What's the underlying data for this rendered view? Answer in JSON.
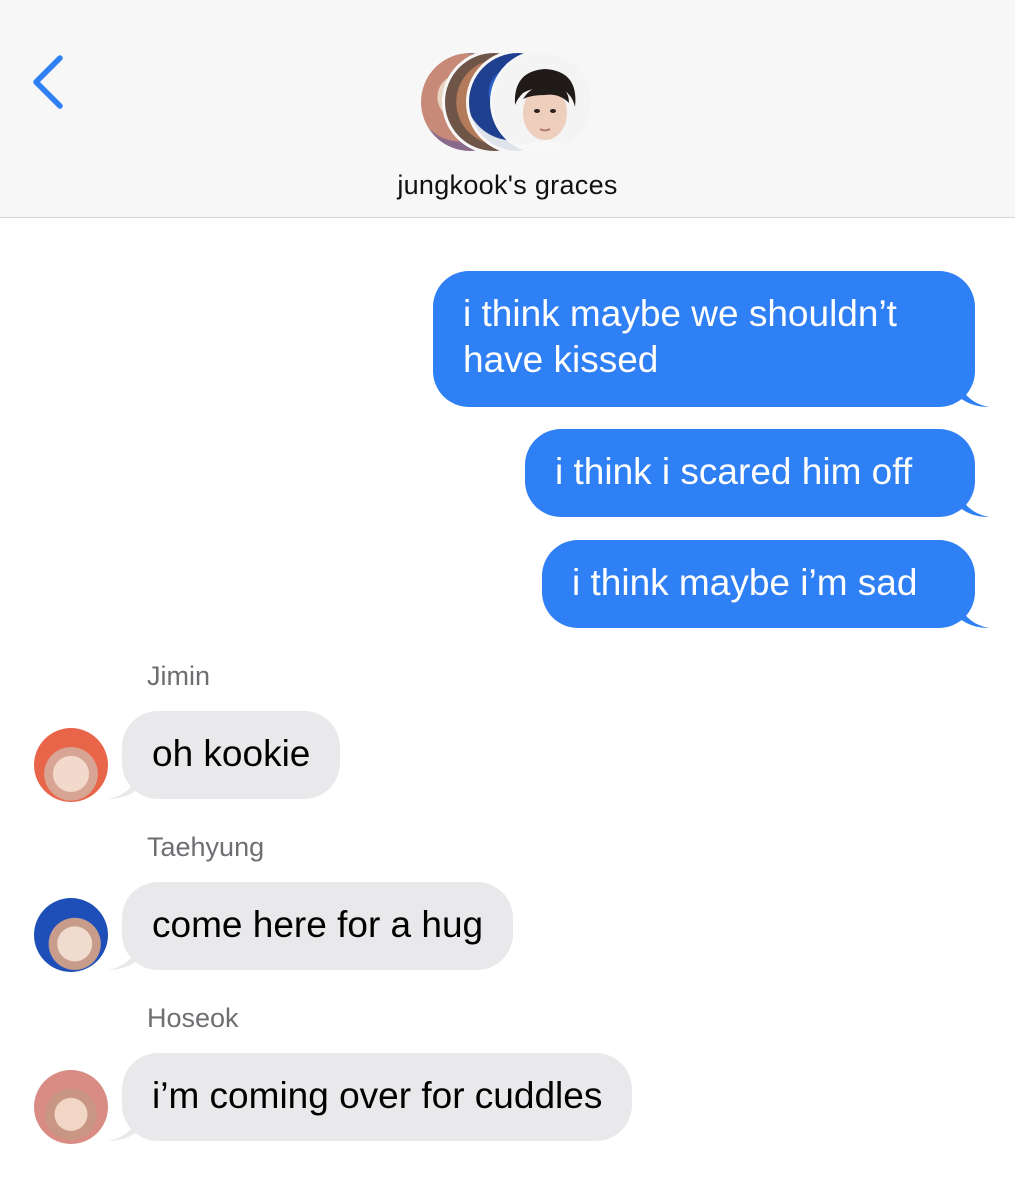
{
  "header": {
    "group_name": "jungkook's graces",
    "avatar_count": 4
  },
  "messages_out": [
    {
      "text": "i think maybe we shouldn’t have kissed"
    },
    {
      "text": "i think i scared him off"
    },
    {
      "text": "i think maybe i’m sad"
    }
  ],
  "messages_in": [
    {
      "sender": "Jimin",
      "text": "oh kookie"
    },
    {
      "sender": "Taehyung",
      "text": "come here for a hug"
    },
    {
      "sender": "Hoseok",
      "text": "i’m coming over for cuddles"
    }
  ],
  "colors": {
    "accent": "#2f7ff5",
    "incoming_bubble": "#e9e9eb",
    "header_bg": "#f7f7f7",
    "sender_label": "#6e6e73"
  }
}
